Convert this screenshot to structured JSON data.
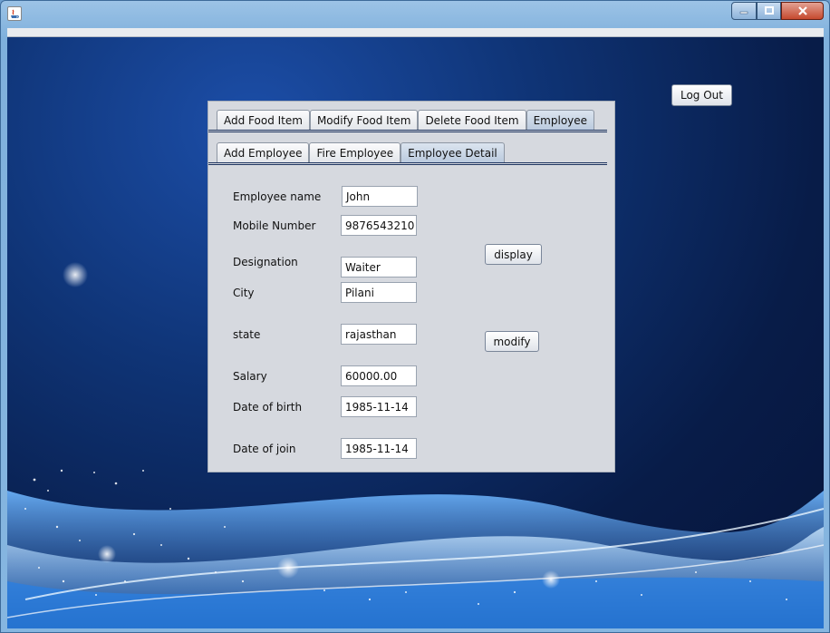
{
  "window": {
    "title": "",
    "controls": {
      "minimize": "minimize-icon",
      "maximize": "maximize-icon",
      "close": "close-icon"
    }
  },
  "header": {
    "logout_label": "Log Out"
  },
  "main_tabs": [
    "Add Food Item",
    "Modify Food Item",
    "Delete Food Item",
    "Employee"
  ],
  "main_tabs_selected": "Employee",
  "sub_tabs": [
    "Add Employee",
    "Fire Employee",
    "Employee Detail"
  ],
  "sub_tabs_selected": "Employee Detail",
  "form": {
    "employee_name": {
      "label": "Employee name",
      "value": "John"
    },
    "mobile_number": {
      "label": "Mobile Number",
      "value": "9876543210"
    },
    "designation": {
      "label": "Designation",
      "value": "Waiter"
    },
    "city": {
      "label": "City",
      "value": "Pilani"
    },
    "state": {
      "label": "state",
      "value": "rajasthan"
    },
    "salary": {
      "label": "Salary",
      "value": "60000.00"
    },
    "date_of_birth": {
      "label": "Date of birth",
      "value": "1985-11-14"
    },
    "date_of_join": {
      "label": "Date of join",
      "value": "1985-11-14"
    }
  },
  "actions": {
    "display_label": "display",
    "modify_label": "modify"
  },
  "colors": {
    "panel_bg": "#d6d9df",
    "tab_selected": "#b9c9dd",
    "desktop_dark": "#081c48"
  }
}
